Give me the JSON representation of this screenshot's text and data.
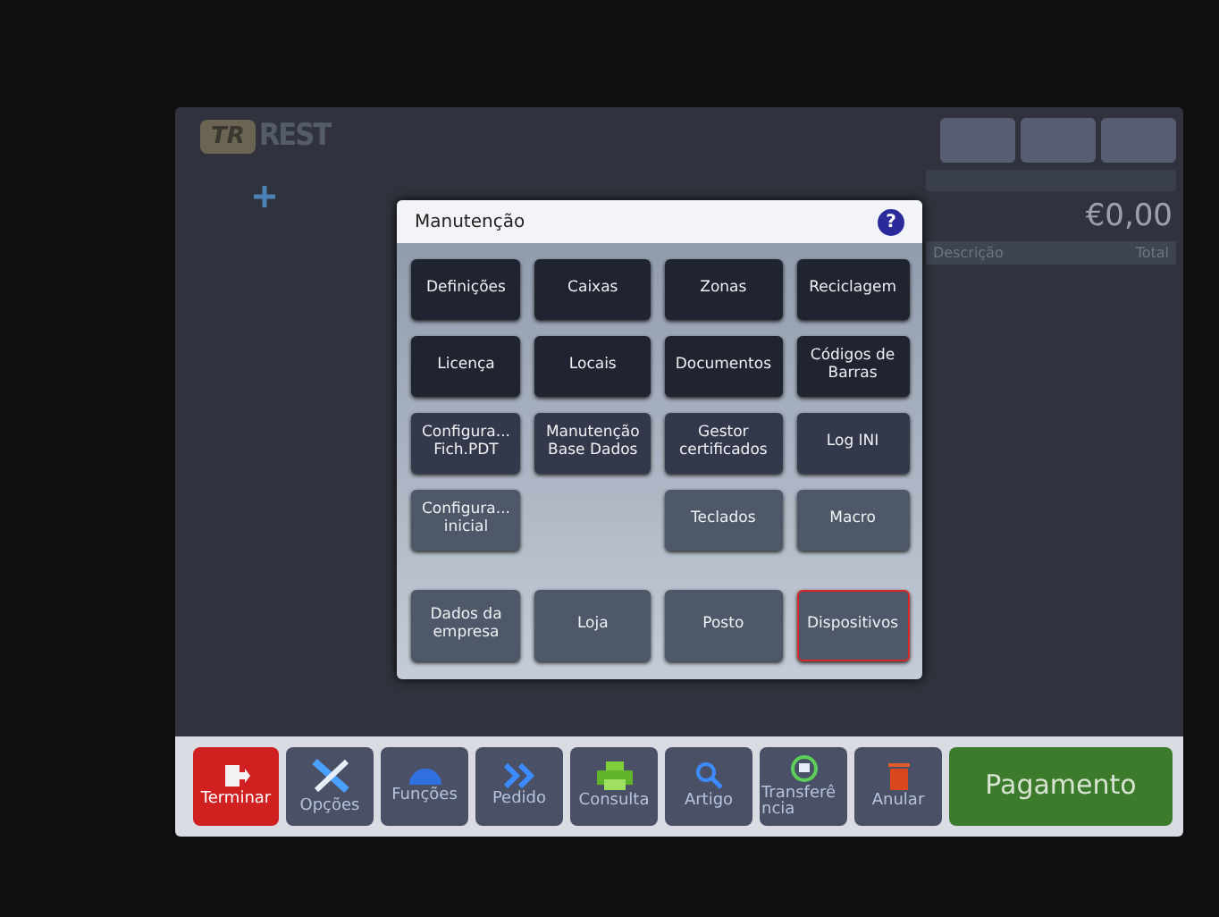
{
  "logo": {
    "mark": "TR",
    "name": "REST"
  },
  "top_buttons": [
    {
      "kind": "blank"
    },
    {
      "kind": "blank"
    },
    {
      "kind": "blank"
    }
  ],
  "total": {
    "amount": "€0,00",
    "columns": [
      "Descrição",
      "Total"
    ]
  },
  "dialog": {
    "title": "Manutenção",
    "help": "?",
    "rows": [
      {
        "buttons": [
          {
            "kind": "dark",
            "label": "Definições",
            "selected": false
          },
          {
            "kind": "dark",
            "label": "Caixas",
            "selected": false
          },
          {
            "kind": "dark",
            "label": "Zonas",
            "selected": false
          },
          {
            "kind": "dark",
            "label": "Reciclagem",
            "selected": false
          }
        ]
      },
      {
        "buttons": [
          {
            "kind": "dark",
            "label": "Licença",
            "selected": false
          },
          {
            "kind": "dark",
            "label": "Locais",
            "selected": false
          },
          {
            "kind": "dark",
            "label": "Documentos",
            "selected": false
          },
          {
            "kind": "dark",
            "label": "Códigos de Barras",
            "selected": false
          }
        ]
      },
      {
        "buttons": [
          {
            "kind": "mid",
            "label": "Configura... Fich.PDT",
            "selected": false
          },
          {
            "kind": "mid",
            "label": "Manutenção Base Dados",
            "selected": false
          },
          {
            "kind": "mid",
            "label": "Gestor certificados",
            "selected": false
          },
          {
            "kind": "mid",
            "label": "Log INI",
            "selected": false
          }
        ]
      },
      {
        "buttons": [
          {
            "kind": "light",
            "label": "Configura... inicial",
            "selected": false
          },
          {
            "kind": "blank"
          },
          {
            "kind": "light",
            "label": "Teclados",
            "selected": false
          },
          {
            "kind": "light",
            "label": "Macro",
            "selected": false
          }
        ]
      },
      {
        "buttons": [
          {
            "kind": "light",
            "label": "Dados da empresa",
            "selected": false
          },
          {
            "kind": "light",
            "label": "Loja",
            "selected": false
          },
          {
            "kind": "light",
            "label": "Posto",
            "selected": false
          },
          {
            "kind": "light",
            "label": "Dispositivos",
            "selected": true
          }
        ]
      }
    ]
  },
  "toolbar": [
    {
      "kind": "exit",
      "label": "Terminar"
    },
    {
      "kind": "tool",
      "label": "Opções"
    },
    {
      "kind": "tool",
      "label": "Funções"
    },
    {
      "kind": "tool",
      "label": "Pedido"
    },
    {
      "kind": "tool",
      "label": "Consulta"
    },
    {
      "kind": "tool",
      "label": "Artigo"
    },
    {
      "kind": "tool",
      "label": "Transferência"
    },
    {
      "kind": "tool",
      "label": "Anular"
    },
    {
      "kind": "pay",
      "label": "Pagamento"
    }
  ]
}
